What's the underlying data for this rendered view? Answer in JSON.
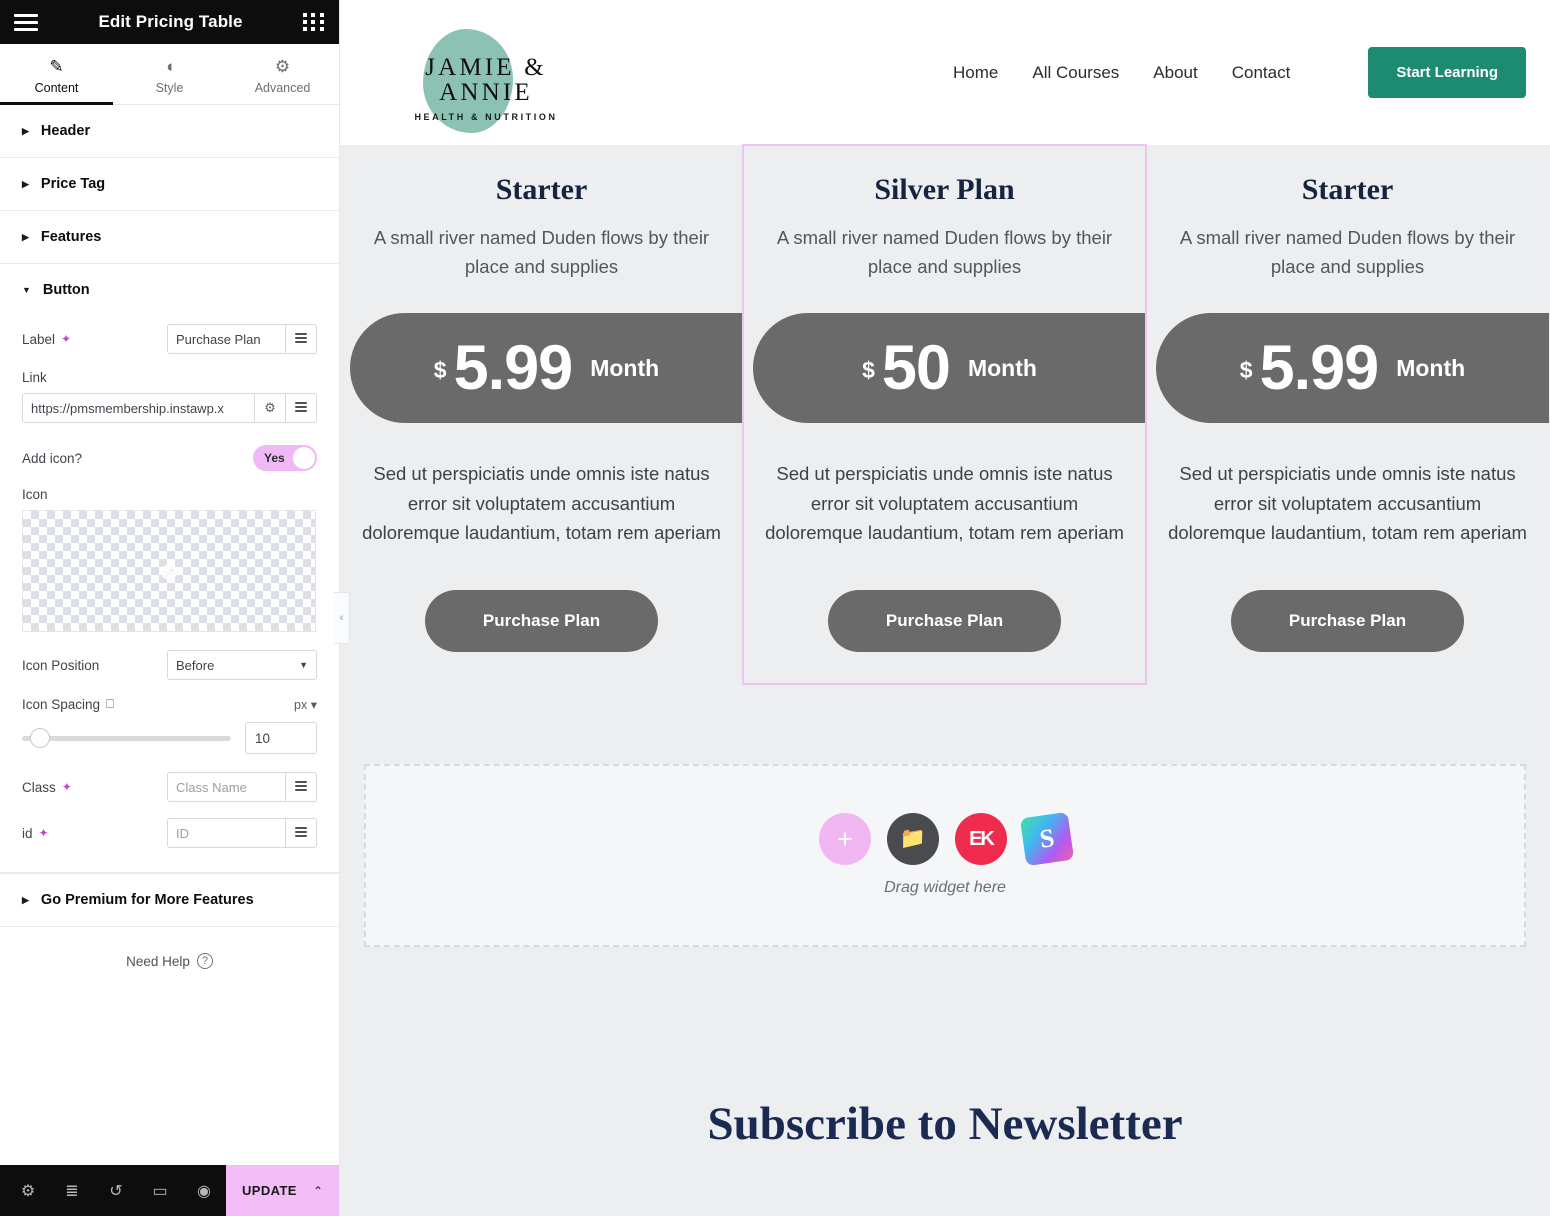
{
  "panel": {
    "title": "Edit Pricing Table",
    "menu_icon": "hamburger-icon",
    "apps_icon": "grid-icon",
    "tabs": [
      {
        "label": "Content",
        "icon": "pencil-icon",
        "active": true
      },
      {
        "label": "Style",
        "icon": "contrast-icon",
        "active": false
      },
      {
        "label": "Advanced",
        "icon": "gear-icon",
        "active": false
      }
    ],
    "sections": [
      {
        "label": "Header",
        "open": false
      },
      {
        "label": "Price Tag",
        "open": false
      },
      {
        "label": "Features",
        "open": false
      },
      {
        "label": "Button",
        "open": true
      }
    ],
    "button_section": {
      "label_field": {
        "label": "Label",
        "value": "Purchase Plan"
      },
      "link_field": {
        "label": "Link",
        "value": "https://pmsmembership.instawp.x"
      },
      "add_icon": {
        "label": "Add icon?",
        "value": "Yes"
      },
      "icon_field": {
        "label": "Icon"
      },
      "icon_position": {
        "label": "Icon Position",
        "value": "Before"
      },
      "icon_spacing": {
        "label": "Icon Spacing",
        "unit": "px",
        "value": "10"
      },
      "class_field": {
        "label": "Class",
        "placeholder": "Class Name"
      },
      "id_field": {
        "label": "id",
        "placeholder": "ID"
      }
    },
    "premium": {
      "label": "Go Premium for More Features"
    },
    "need_help": {
      "label": "Need Help"
    },
    "footer": {
      "tools": [
        {
          "name": "settings-icon",
          "glyph": "⚙"
        },
        {
          "name": "layers-icon",
          "glyph": "≣"
        },
        {
          "name": "history-icon",
          "glyph": "↺"
        },
        {
          "name": "responsive-icon",
          "glyph": "▭"
        },
        {
          "name": "preview-icon",
          "glyph": "◉"
        }
      ],
      "update_label": "UPDATE",
      "update_caret": "⌃"
    },
    "collapse_handle": "‹"
  },
  "site": {
    "logo": {
      "main": "JAMIE & ANNIE",
      "sub": "HEALTH & NUTRITION",
      "blob_color": "#8cc2b4"
    },
    "nav": [
      "Home",
      "All Courses",
      "About",
      "Contact"
    ],
    "cta": {
      "label": "Start Learning",
      "color": "#1d8a72"
    },
    "cards": [
      {
        "title": "Starter",
        "subtitle": "A small river named Duden flows by their place and supplies",
        "currency": "$",
        "amount": "5.99",
        "period": "Month",
        "body": "Sed ut perspiciatis unde omnis iste natus error sit voluptatem accusantium doloremque laudantium, totam rem aperiam",
        "button": "Purchase Plan",
        "selected": false
      },
      {
        "title": "Silver Plan",
        "subtitle": "A small river named Duden flows by their place and supplies",
        "currency": "$",
        "amount": "50",
        "period": "Month",
        "body": "Sed ut perspiciatis unde omnis iste natus error sit voluptatem accusantium doloremque laudantium, totam rem aperiam",
        "button": "Purchase Plan",
        "selected": true
      },
      {
        "title": "Starter",
        "subtitle": "A small river named Duden flows by their place and supplies",
        "currency": "$",
        "amount": "5.99",
        "period": "Month",
        "body": "Sed ut perspiciatis unde omnis iste natus error sit voluptatem accusantium doloremque laudantium, totam rem aperiam",
        "button": "Purchase Plan",
        "selected": false
      }
    ],
    "drop_zone": {
      "label": "Drag widget here",
      "icons": [
        {
          "name": "add-widget-icon",
          "glyph": "+"
        },
        {
          "name": "folder-icon",
          "glyph": "▰"
        },
        {
          "name": "elementskit-icon",
          "glyph": "EK"
        },
        {
          "name": "shortcode-icon",
          "glyph": "S"
        }
      ]
    },
    "newsletter_heading": "Subscribe to Newsletter"
  }
}
